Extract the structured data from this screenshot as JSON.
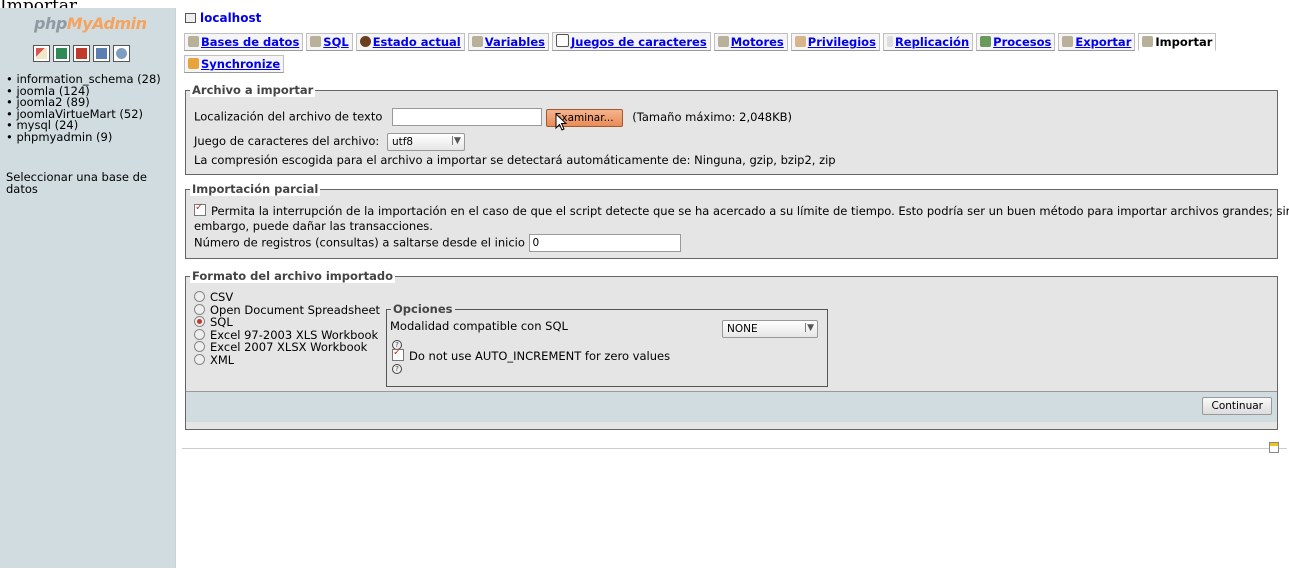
{
  "top_fragment": "Importar",
  "logo": {
    "php": "php",
    "myadmin": "MyAdmin"
  },
  "sidebar": {
    "icons": [
      "home-icon",
      "query-window-icon",
      "sql-docs-icon",
      "docs-icon",
      "reload-icon"
    ],
    "databases": [
      "information_schema (28)",
      "joomla (124)",
      "joomla2 (89)",
      "joomlaVirtueMart (52)",
      "mysql (24)",
      "phpmyadmin (9)"
    ],
    "select_db_text": "Seleccionar una base de datos"
  },
  "server": {
    "label": "localhost"
  },
  "tabs": [
    {
      "label": "Bases de datos",
      "icon": "databases-icon"
    },
    {
      "label": "SQL",
      "icon": "sql-icon"
    },
    {
      "label": "Estado actual",
      "icon": "status-icon"
    },
    {
      "label": "Variables",
      "icon": "variables-icon"
    },
    {
      "label": "Juegos de caracteres",
      "icon": "charsets-icon"
    },
    {
      "label": "Motores",
      "icon": "engines-icon"
    },
    {
      "label": "Privilegios",
      "icon": "privileges-icon"
    },
    {
      "label": "Replicación",
      "icon": "replication-icon"
    },
    {
      "label": "Procesos",
      "icon": "processes-icon"
    },
    {
      "label": "Exportar",
      "icon": "export-icon"
    },
    {
      "label": "Importar",
      "icon": "import-icon",
      "active": true
    },
    {
      "label": "Synchronize",
      "icon": "synchronize-icon"
    }
  ],
  "archivo": {
    "legend": "Archivo a importar",
    "location_label": "Localización del archivo de texto",
    "browse_label": "Examinar...",
    "max_size": "(Tamaño máximo: 2,048KB)",
    "charset_label": "Juego de caracteres del archivo:",
    "charset_value": "utf8",
    "compression_text": "La compresión escogida para el archivo a importar se detectará automáticamente de: Ninguna, gzip, bzip2, zip"
  },
  "parcial": {
    "legend": "Importación parcial",
    "allow_interrupt_line1": "Permita la interrupción de la importación en el caso de que el script detecte que se ha acercado a su límite de tiempo. Esto podría ser un buen método para importar archivos grandes; sin",
    "allow_interrupt_line2": "embargo, puede dañar las transacciones.",
    "skip_label": "Número de registros (consultas) a saltarse desde el inicio",
    "skip_value": "0"
  },
  "formato": {
    "legend": "Formato del archivo importado",
    "formats": [
      {
        "label": "CSV",
        "selected": false
      },
      {
        "label": "Open Document Spreadsheet",
        "selected": false
      },
      {
        "label": "SQL",
        "selected": true
      },
      {
        "label": "Excel 97-2003 XLS Workbook",
        "selected": false
      },
      {
        "label": "Excel 2007 XLSX Workbook",
        "selected": false
      },
      {
        "label": "XML",
        "selected": false
      }
    ],
    "opciones": {
      "legend": "Opciones",
      "compat_label": "Modalidad compatible con SQL",
      "compat_value": "NONE",
      "auto_increment_label": "Do not use AUTO_INCREMENT for zero values"
    },
    "submit_label": "Continuar"
  }
}
